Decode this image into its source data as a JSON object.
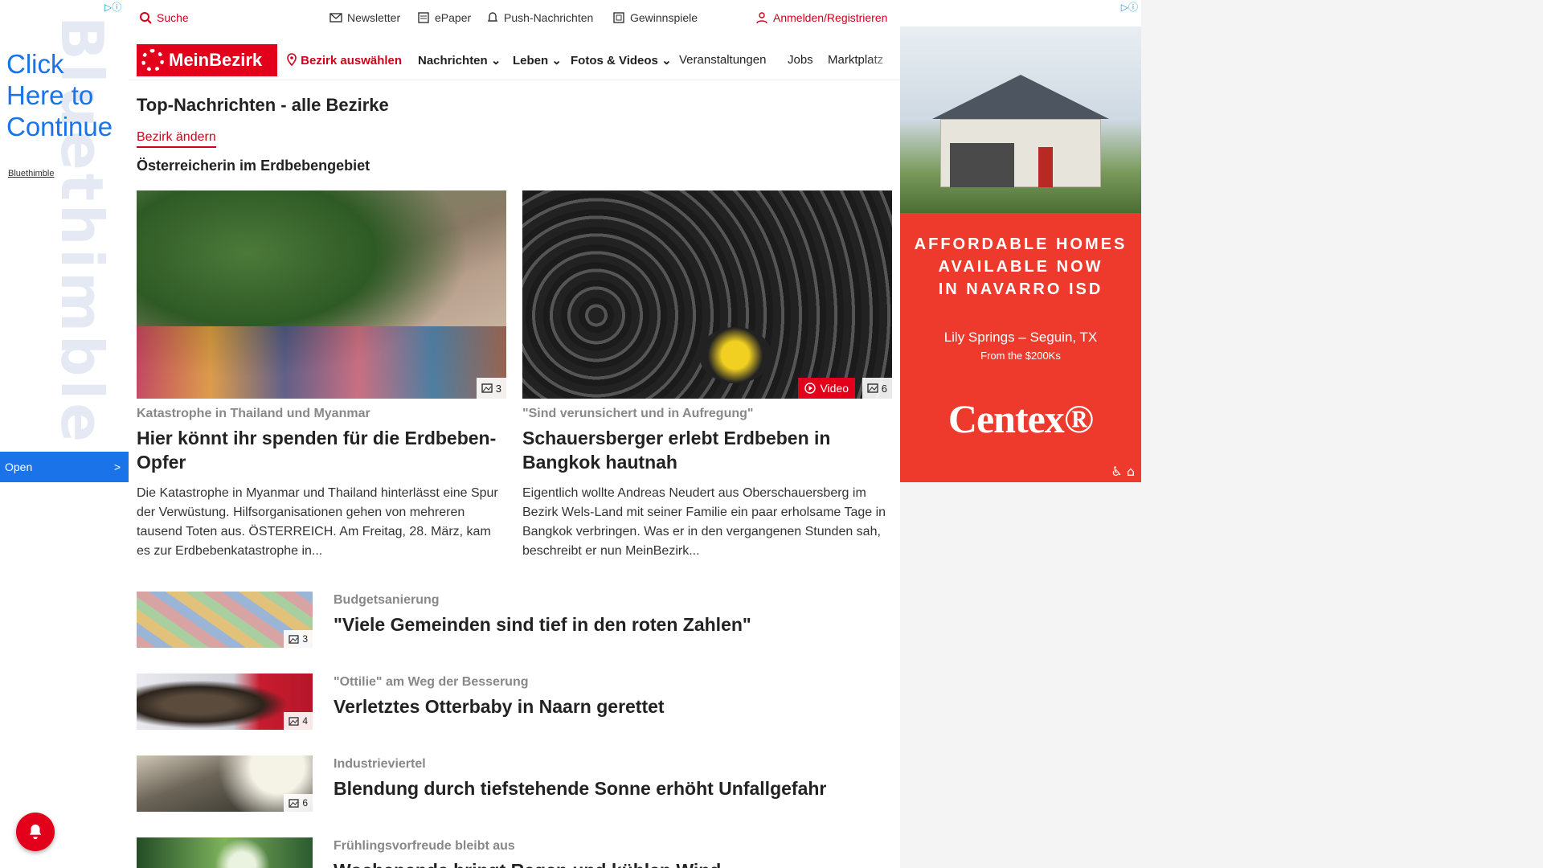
{
  "left_ad": {
    "corner_label": "▷ⓘ",
    "watermark": "Bluethimble",
    "click_text": "Click Here to Continue",
    "brand": "Bluethimble",
    "open_label": "Open",
    "open_chevron": ">"
  },
  "topbar": {
    "search": "Suche",
    "newsletter": "Newsletter",
    "epaper": "ePaper",
    "push": "Push-Nachrichten",
    "gewinnspiele": "Gewinnspiele",
    "login": "Anmelden/Registrieren"
  },
  "nav": {
    "logo": "MeinBezirk",
    "bezirk": "Bezirk auswählen",
    "items": [
      "Nachrichten ⌄",
      "Leben ⌄",
      "Fotos & Videos ⌄",
      "Veranstaltungen",
      "Jobs",
      "Marktplatz"
    ]
  },
  "main": {
    "title": "Top-Nachrichten - alle Bezirke",
    "change_link": "Bezirk ändern",
    "subheading": "Österreicherin im Erdbebengebiet",
    "cards": [
      {
        "kicker": "Katastrophe in Thailand und Myanmar",
        "headline": "Hier könnt ihr spenden für die Erdbeben-Opfer",
        "teaser": "Die Katastrophe in Myanmar und Thailand hinterlässt eine Spur der Verwüstung. Hilfsorganisationen gehen von mehreren tausend Toten aus.  ÖSTERREICH. Am Freitag, 28. März, kam es zur Erdbebenkatastrophe in...",
        "photo_count": "3"
      },
      {
        "kicker": "\"Sind verunsichert und in Aufregung\"",
        "headline": "Schauersberger erlebt Erdbeben in Bangkok hautnah",
        "teaser": "Eigentlich wollte Andreas Neudert aus Oberschauersberg im Bezirk Wels-Land mit seiner Familie ein paar erholsame Tage in Bangkok verbringen. Was er in den vergangenen Stunden sah, beschreibt er nun MeinBezirk...",
        "photo_count": "6",
        "video_label": "Video"
      }
    ],
    "list": [
      {
        "kicker": "Budgetsanierung",
        "headline": "\"Viele Gemeinden sind tief in den roten Zahlen\"",
        "photo_count": "3"
      },
      {
        "kicker": "\"Ottilie\" am Weg der Besserung",
        "headline": "Verletztes Otterbaby in Naarn gerettet",
        "photo_count": "4"
      },
      {
        "kicker": "Industrieviertel",
        "headline": "Blendung durch tiefstehende Sonne erhöht Unfallgefahr",
        "photo_count": "6"
      },
      {
        "kicker": "Frühlingsvorfreude bleibt aus",
        "headline": "Wochenende bringt Regen und kühlen Wind",
        "photo_count": ""
      }
    ]
  },
  "right_ad": {
    "corner_label": "▷ⓘ",
    "headline_lines": [
      "AFFORDABLE HOMES",
      "AVAILABLE NOW",
      "IN NAVARRO ISD"
    ],
    "location": "Lily Springs – Seguin, TX",
    "price": "From the $200Ks",
    "brand": "Centex®"
  },
  "colors": {
    "brand_red": "#e3001b",
    "link_red": "#d0021b",
    "ad_red": "#ee3a2c",
    "ad_blue": "#1a73e8"
  },
  "icons": [
    "search-icon",
    "mail-icon",
    "newspaper-icon",
    "bell-icon",
    "gift-icon",
    "user-icon",
    "location-pin-icon",
    "image-icon",
    "play-icon",
    "chevron-right-icon"
  ]
}
